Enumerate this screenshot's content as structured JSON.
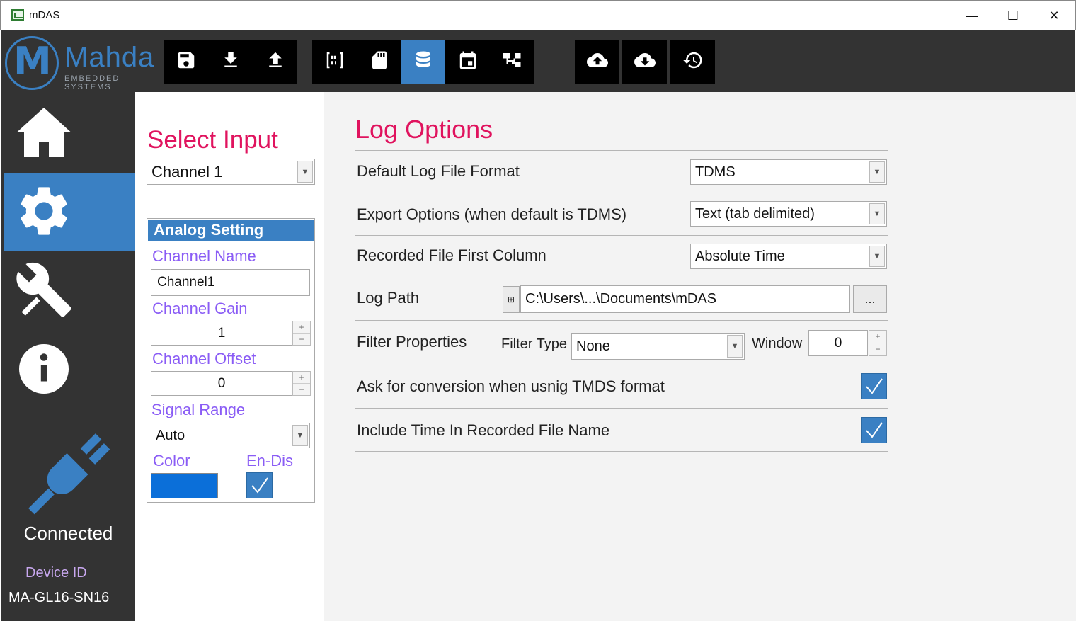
{
  "window": {
    "title": "mDAS",
    "minimize_glyph": "—",
    "maximize_glyph": "☐",
    "close_glyph": "✕"
  },
  "logo": {
    "letter": "M",
    "brand": "Mahda",
    "tagline": "EMBEDDED SYSTEMS"
  },
  "toolbar": {
    "groups": [
      [
        "save-icon",
        "download-icon",
        "upload-icon"
      ],
      [
        "binary-icon",
        "sd-card-icon",
        "database-icon",
        "calendar-icon",
        "hierarchy-icon"
      ],
      [
        "cloud-upload-icon",
        "cloud-download-icon",
        "history-icon"
      ]
    ],
    "active": "database-icon"
  },
  "sidebar": {
    "items": [
      "home-icon",
      "settings-gear-icon",
      "tools-icon",
      "info-icon"
    ],
    "active": "settings-gear-icon",
    "status": "Connected",
    "device_id_label": "Device ID",
    "device_id": "MA-GL16-SN16"
  },
  "select_input": {
    "title": "Select Input",
    "value": "Channel 1"
  },
  "analog": {
    "header": "Analog Setting",
    "channel_name_label": "Channel Name",
    "channel_name": "Channel1",
    "gain_label": "Channel Gain",
    "gain": "1",
    "offset_label": "Channel Offset",
    "offset": "0",
    "range_label": "Signal Range",
    "range": "Auto",
    "color_label": "Color",
    "color": "#0b6fd9",
    "endis_label": "En-Dis",
    "endis_checked": true
  },
  "log_options": {
    "title": "Log Options",
    "default_format_label": "Default Log File Format",
    "default_format": "TDMS",
    "export_label": "Export Options (when default is TDMS)",
    "export": "Text (tab delimited)",
    "first_column_label": "Recorded File First Column",
    "first_column": "Absolute Time",
    "log_path_label": "Log Path",
    "log_path": "C:\\Users\\...\\Documents\\mDAS",
    "browse_label": "...",
    "filter_label": "Filter Properties",
    "filter_type_label": "Filter Type",
    "filter_type": "None",
    "window_label": "Window",
    "window": "0",
    "ask_conversion_label": "Ask for conversion when usnig TMDS format",
    "ask_conversion_checked": true,
    "include_time_label": "Include Time In Recorded File Name",
    "include_time_checked": true
  },
  "colors": {
    "accent": "#3a80c3",
    "title_red": "#e0135e",
    "label_purple": "#8a5cf5",
    "dark_bg": "#333333"
  }
}
